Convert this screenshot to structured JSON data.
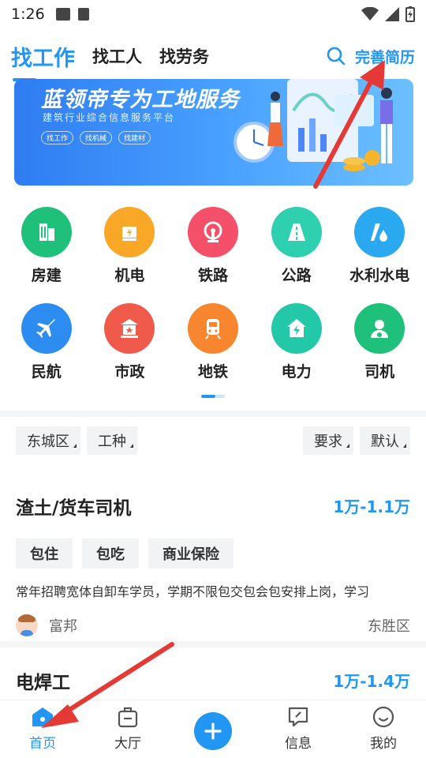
{
  "status": {
    "time": "1:26"
  },
  "tabs": {
    "find_job": "找工作",
    "find_worker": "找工人",
    "find_labor": "找劳务",
    "complete_resume": "完善简历"
  },
  "banner": {
    "title": "蓝领帝专为工地服务",
    "subtitle": "建筑行业综合信息服务平台",
    "chips": [
      "找工作",
      "找机械",
      "找建材"
    ]
  },
  "categories": {
    "row1": [
      {
        "label": "房建",
        "color": "#1fc17a",
        "icon": "building-icon"
      },
      {
        "label": "机电",
        "color": "#f8a826",
        "icon": "motor-icon"
      },
      {
        "label": "铁路",
        "color": "#f4506a",
        "icon": "railway-icon"
      },
      {
        "label": "公路",
        "color": "#2fd0b0",
        "icon": "road-icon"
      },
      {
        "label": "水利水电",
        "color": "#2aa8f0",
        "icon": "water-icon"
      }
    ],
    "row2": [
      {
        "label": "民航",
        "color": "#2d8cf0",
        "icon": "airplane-icon"
      },
      {
        "label": "市政",
        "color": "#ef5a4a",
        "icon": "city-icon"
      },
      {
        "label": "地铁",
        "color": "#f7862e",
        "icon": "subway-icon"
      },
      {
        "label": "电力",
        "color": "#22c8a8",
        "icon": "power-icon"
      },
      {
        "label": "司机",
        "color": "#1ec07a",
        "icon": "driver-icon"
      }
    ]
  },
  "filters": {
    "district": "东城区",
    "job_type": "工种",
    "requirement": "要求",
    "sort": "默认"
  },
  "jobs": [
    {
      "title": "渣土/货车司机",
      "salary": "1万-1.1万",
      "tags": [
        "包住",
        "包吃",
        "商业保险"
      ],
      "desc": "常年招聘宽体自卸车学员，学期不限包交包会包安排上岗，学习",
      "company": "富邦",
      "area": "东胜区"
    },
    {
      "title": "电焊工",
      "salary": "1万-1.4万"
    }
  ],
  "bottom_nav": {
    "home": "首页",
    "hall": "大厅",
    "messages": "信息",
    "mine": "我的"
  },
  "colors": {
    "accent": "#2196f3"
  }
}
